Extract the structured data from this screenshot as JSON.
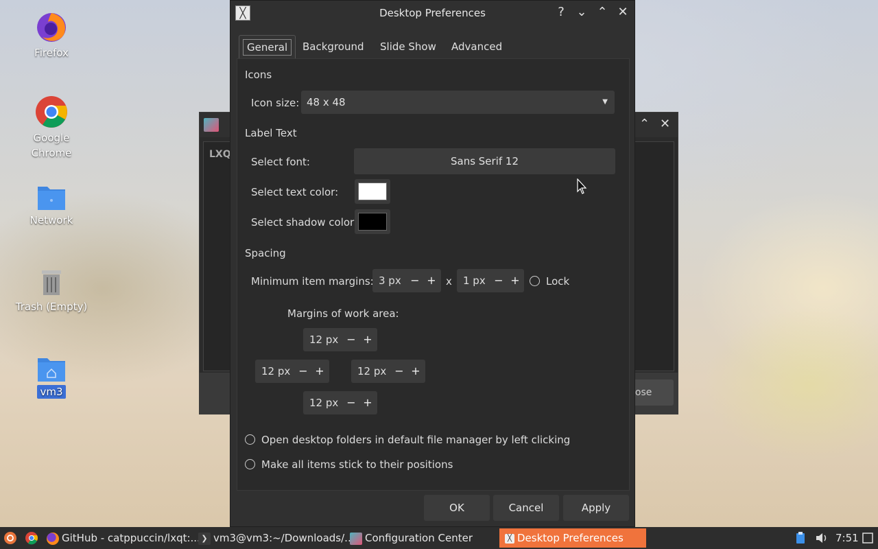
{
  "desktop": {
    "icons": [
      {
        "label": "Firefox",
        "icon": "firefox-icon"
      },
      {
        "label": "Google Chrome",
        "icon": "chrome-icon"
      },
      {
        "label": "Network",
        "icon": "network-folder-icon"
      },
      {
        "label": "Trash (Empty)",
        "icon": "trash-icon"
      },
      {
        "label": "vm3",
        "icon": "home-folder-icon"
      }
    ]
  },
  "background_window": {
    "title_fragment": "LXQ",
    "close_label": "lose"
  },
  "dialog": {
    "title": "Desktop Preferences",
    "controls": {
      "help": "?",
      "minimize": "⌄",
      "maximize": "⌃",
      "close": "✕"
    },
    "tabs": [
      {
        "label": "General",
        "active": true
      },
      {
        "label": "Background",
        "active": false
      },
      {
        "label": "Slide Show",
        "active": false
      },
      {
        "label": "Advanced",
        "active": false
      }
    ],
    "icons_section": {
      "heading": "Icons",
      "icon_size_label": "Icon size:",
      "icon_size_value": "48 x 48"
    },
    "label_text_section": {
      "heading": "Label Text",
      "select_font_label": "Select font:",
      "font_value": "Sans Serif 12",
      "text_color_label": "Select text color:",
      "text_color": "#ffffff",
      "shadow_color_label": "Select shadow color:",
      "shadow_color": "#000000"
    },
    "spacing_section": {
      "heading": "Spacing",
      "min_margins_label": "Minimum item margins:",
      "margin_x": "3 px",
      "separator": "x",
      "margin_y": "1 px",
      "lock_label": "Lock",
      "work_area_label": "Margins of work area:",
      "work_area_top": "12 px",
      "work_area_left": "12 px",
      "work_area_right": "12 px",
      "work_area_bottom": "12 px"
    },
    "options": {
      "open_folders_label": "Open desktop folders in default file manager by left clicking",
      "stick_items_label": "Make all items stick to their positions"
    },
    "buttons": {
      "ok": "OK",
      "cancel": "Cancel",
      "apply": "Apply"
    }
  },
  "taskbar": {
    "items": [
      {
        "label": "GitHub - catppuccin/lxqt:...",
        "icon": "firefox-icon"
      },
      {
        "label": "vm3@vm3:~/Downloads/...",
        "icon": "terminal-icon"
      },
      {
        "label": "Configuration Center",
        "icon": "config-center-icon"
      },
      {
        "label": "Desktop Preferences",
        "icon": "desktop-prefs-icon",
        "active": true
      }
    ],
    "clock": "7:51",
    "accent": "#f0733c"
  }
}
